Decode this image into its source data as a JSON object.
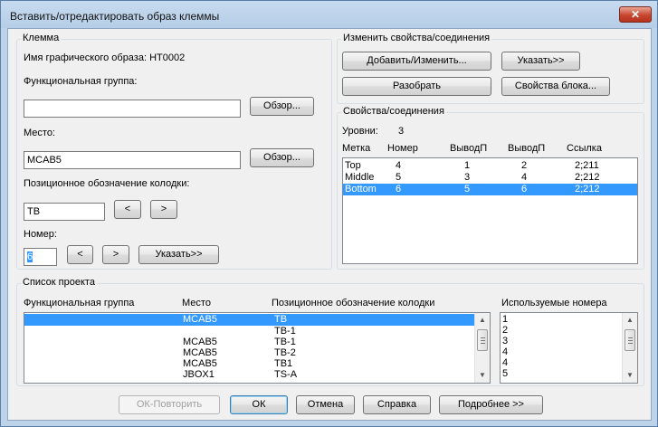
{
  "window": {
    "title": "Вставить/отредактировать образ клеммы",
    "close_label": "✕"
  },
  "terminal": {
    "group_title": "Клемма",
    "graphic_name_label": "Имя графического образа: HT0002",
    "func_group_label": "Функциональная группа:",
    "func_group_value": "",
    "browse_label": "Обзор...",
    "location_label": "Место:",
    "location_value": "MCAB5",
    "strip_label": "Позиционное обозначение колодки:",
    "strip_value": "TB",
    "prev_label": "<",
    "next_label": ">",
    "number_label": "Номер:",
    "number_value": "6",
    "pick_label": "Указать>>"
  },
  "props": {
    "group_title": "Изменить свойства/соединения",
    "add_modify_label": "Добавить/Изменить...",
    "pick_label": "Указать>>",
    "break_label": "Разобрать",
    "block_props_label": "Свойства блока..."
  },
  "connections": {
    "group_title": "Свойства/соединения",
    "levels_label": "Уровни:",
    "levels_value": "3",
    "columns": [
      "Метка",
      "Номер",
      "ВыводП",
      "ВыводП",
      "Ссылка"
    ],
    "rows": [
      [
        "Top",
        "4",
        "1",
        "2",
        "2;211"
      ],
      [
        "Middle",
        "5",
        "3",
        "4",
        "2;212"
      ],
      [
        "Bottom",
        "6",
        "5",
        "6",
        "2;212"
      ]
    ]
  },
  "project": {
    "group_title": "Список проекта",
    "columns": [
      "Функциональная группа",
      "Место",
      "Позиционное обозначение колодки"
    ],
    "rows": [
      [
        "",
        "MCAB5",
        "TB"
      ],
      [
        "",
        "",
        "TB-1"
      ],
      [
        "",
        "MCAB5",
        "TB-1"
      ],
      [
        "",
        "MCAB5",
        "TB-2"
      ],
      [
        "",
        "MCAB5",
        "TB1"
      ],
      [
        "",
        "JBOX1",
        "TS-A"
      ]
    ],
    "used_numbers_label": "Используемые номера",
    "used_numbers": [
      "1",
      "2",
      "3",
      "4",
      "4",
      "5"
    ]
  },
  "footer": {
    "ok_repeat_label": "ОК-Повторить",
    "ok_label": "ОК",
    "cancel_label": "Отмена",
    "help_label": "Справка",
    "details_label": "Подробнее >>"
  },
  "colors": {
    "selection": "#3399ff",
    "titlebar": "#b9d1ea",
    "dialog_bg": "#f0f0f0"
  }
}
